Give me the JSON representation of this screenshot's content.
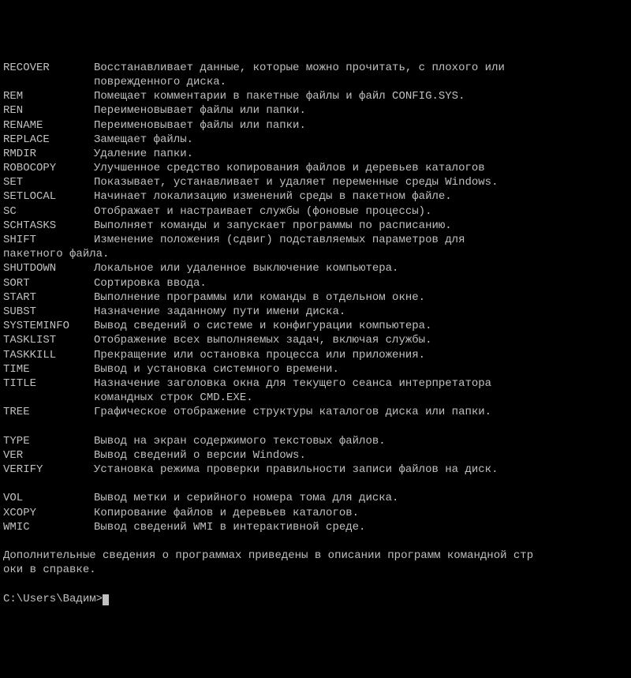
{
  "commands": [
    {
      "name": "RECOVER",
      "desc": "Восстанавливает данные, которые можно прочитать, с плохого или",
      "cont": "поврежденного диска."
    },
    {
      "name": "REM",
      "desc": "Помещает комментарии в пакетные файлы и файл CONFIG.SYS."
    },
    {
      "name": "REN",
      "desc": "Переименовывает файлы или папки."
    },
    {
      "name": "RENAME",
      "desc": "Переименовывает файлы или папки."
    },
    {
      "name": "REPLACE",
      "desc": "Замещает файлы."
    },
    {
      "name": "RMDIR",
      "desc": "Удаление папки."
    },
    {
      "name": "ROBOCOPY",
      "desc": "Улучшенное средство копирования файлов и деревьев каталогов"
    },
    {
      "name": "SET",
      "desc": "Показывает, устанавливает и удаляет переменные среды Windows."
    },
    {
      "name": "SETLOCAL",
      "desc": "Начинает локализацию изменений среды в пакетном файле."
    },
    {
      "name": "SC",
      "desc": "Отображает и настраивает службы (фоновые процессы)."
    },
    {
      "name": "SCHTASKS",
      "desc": "Выполняет команды и запускает программы по расписанию."
    },
    {
      "name": "SHIFT",
      "desc": "Изменение положения (сдвиг) подставляемых параметров для"
    }
  ],
  "shift_wrap": "пакетного файла.",
  "commands2": [
    {
      "name": "SHUTDOWN",
      "desc": "Локальное или удаленное выключение компьютера."
    },
    {
      "name": "SORT",
      "desc": "Сортировка ввода."
    },
    {
      "name": "START",
      "desc": "Выполнение программы или команды в отдельном окне."
    },
    {
      "name": "SUBST",
      "desc": "Назначение заданному пути имени диска."
    },
    {
      "name": "SYSTEMINFO",
      "desc": "Вывод сведений о системе и конфигурации компьютера."
    },
    {
      "name": "TASKLIST",
      "desc": "Отображение всех выполняемых задач, включая службы."
    },
    {
      "name": "TASKKILL",
      "desc": "Прекращение или остановка процесса или приложения."
    },
    {
      "name": "TIME",
      "desc": "Вывод и установка системного времени."
    },
    {
      "name": "TITLE",
      "desc": "Назначение заголовка окна для текущего сеанса интерпретатора",
      "cont": "командных строк CMD.EXE."
    },
    {
      "name": "TREE",
      "desc": "Графическое отображение структуры каталогов диска или папки."
    }
  ],
  "commands3": [
    {
      "name": "TYPE",
      "desc": "Вывод на экран содержимого текстовых файлов."
    },
    {
      "name": "VER",
      "desc": "Вывод сведений о версии Windows."
    },
    {
      "name": "VERIFY",
      "desc": "Установка режима проверки правильности записи файлов на диск."
    }
  ],
  "commands4": [
    {
      "name": "VOL",
      "desc": "Вывод метки и серийного номера тома для диска."
    },
    {
      "name": "XCOPY",
      "desc": "Копирование файлов и деревьев каталогов."
    },
    {
      "name": "WMIC",
      "desc": "Вывод сведений WMI в интерактивной среде."
    }
  ],
  "footer1": "Дополнительные сведения о программах приведены в описании программ командной стр",
  "footer2": "оки в справке.",
  "prompt": "C:\\Users\\Вадим>"
}
